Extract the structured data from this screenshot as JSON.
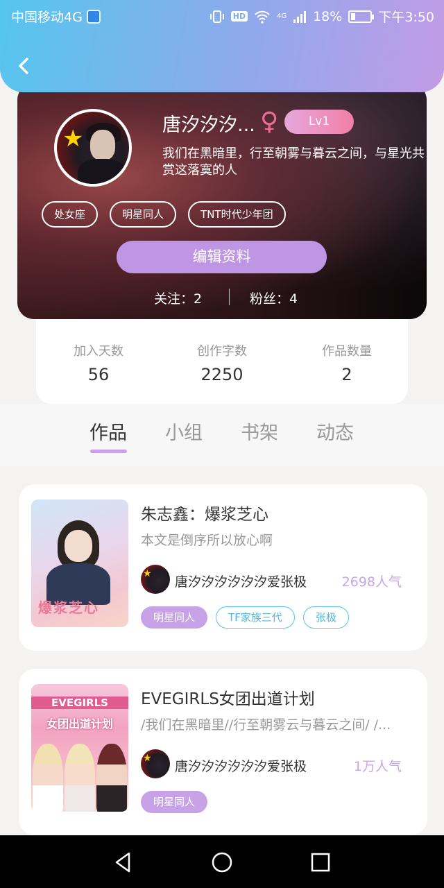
{
  "status_bar": {
    "carrier": "中国移动4G",
    "hd": "HD",
    "network": "4G",
    "battery": "18%",
    "time": "下午3:50"
  },
  "profile": {
    "username": "唐汐汐汐...",
    "gender_symbol": "♀",
    "level": "Lv1",
    "bio": "我们在黑暗里，行至朝雾与暮云之间，与星光共赏这落寞的人",
    "tags": [
      "处女座",
      "明星同人",
      "TNT时代少年团"
    ],
    "edit_label": "编辑资料",
    "following": "关注：2",
    "followers": "粉丝：4"
  },
  "stats": [
    {
      "label": "加入天数",
      "value": "56"
    },
    {
      "label": "创作字数",
      "value": "2250"
    },
    {
      "label": "作品数量",
      "value": "2"
    }
  ],
  "tabs": [
    "作品",
    "小组",
    "书架",
    "动态"
  ],
  "active_tab": "作品",
  "works": [
    {
      "title": "朱志鑫：爆浆芝心",
      "desc": "本文是倒序所以放心啊",
      "author": "唐汐汐汐汐汐汐爱张极",
      "popularity": "2698人气",
      "cover_text": "爆浆芝心",
      "tags": [
        {
          "text": "明星同人",
          "style": "filled"
        },
        {
          "text": "TF家族三代",
          "style": "outline"
        },
        {
          "text": "张极",
          "style": "outline"
        }
      ]
    },
    {
      "title": "EVEGIRLS女团出道计划",
      "desc": "/我们在黑暗里//行至朝雾云与暮云之间/ /...",
      "author": "唐汐汐汐汐汐汐爱张极",
      "popularity": "1万人气",
      "cover_head": "EVEGIRLS",
      "cover_sub": "女团出道计划",
      "tags": [
        {
          "text": "明星同人",
          "style": "filled"
        }
      ]
    }
  ],
  "colors": {
    "accent_purple": "#be96e4",
    "header_gradient_start": "#55c6ee",
    "header_gradient_end": "#c29be6",
    "outline_tag_blue": "#58c4e6",
    "popularity_text": "#c8a6e6"
  },
  "icons": {
    "back": "chevron-left-icon",
    "gender": "female-icon",
    "nav_back": "triangle-back-icon",
    "nav_home": "circle-home-icon",
    "nav_recent": "square-recent-icon"
  }
}
